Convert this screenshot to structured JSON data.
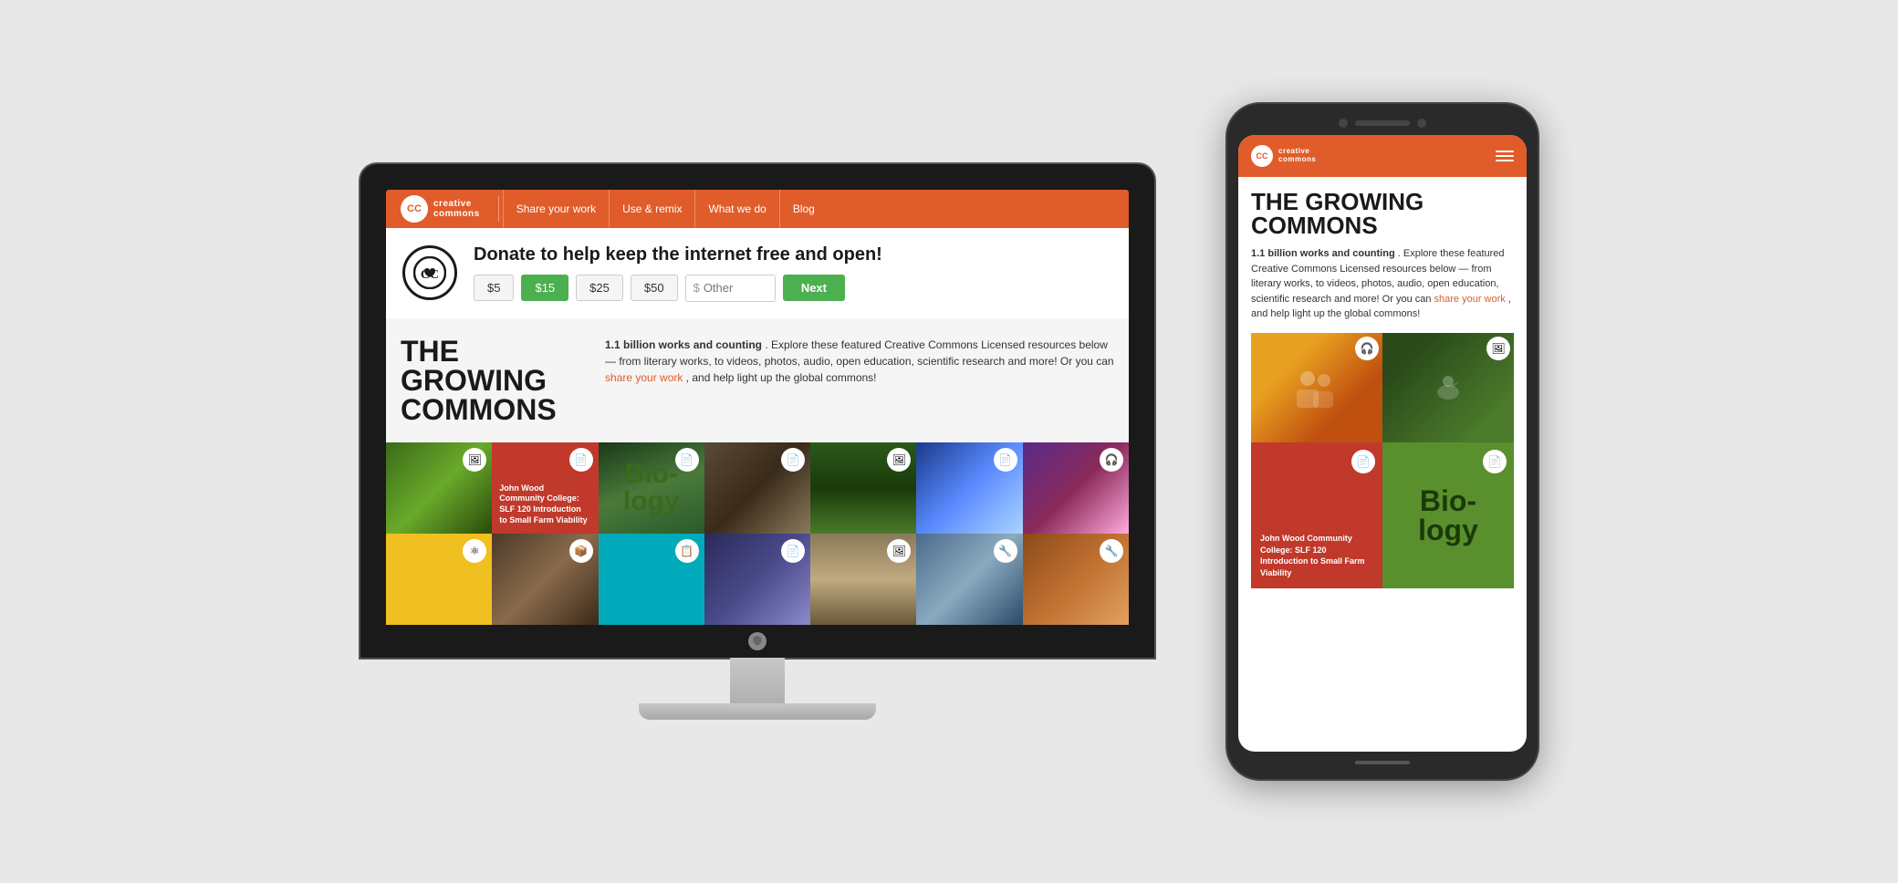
{
  "scene": {
    "bg_color": "#e8e8e8"
  },
  "imac": {
    "nav": {
      "logo_text_line1": "creative",
      "logo_text_line2": "commons",
      "logo_icon": "CC",
      "links": [
        {
          "label": "Share your work"
        },
        {
          "label": "Use & remix"
        },
        {
          "label": "What we do"
        },
        {
          "label": "Blog"
        }
      ]
    },
    "donate": {
      "heading": "Donate to help keep the internet free and open!",
      "amounts": [
        "$5",
        "$15",
        "$25",
        "$50"
      ],
      "active_amount": "$15",
      "other_placeholder": "Other",
      "currency_symbol": "$",
      "next_label": "Next"
    },
    "growing": {
      "title": "THE GROWING COMMONS",
      "desc_strong": "1.1 billion works and counting",
      "desc_rest": ". Explore these featured Creative Commons Licensed resources below — from literary works, to videos, photos, audio, open education, scientific research and more! Or you can ",
      "desc_link": "share your work",
      "desc_end": ", and help light up the global commons!"
    },
    "grid": {
      "row1": [
        {
          "type": "image",
          "img_class": "img-hbird",
          "icon": "🖼",
          "label": ""
        },
        {
          "type": "text_over_red",
          "text": "John Wood Community College: SLF 120 Introduction to Small Farm Viability",
          "icon": "📄"
        },
        {
          "type": "bio_text",
          "text": "Bio-logy",
          "img_class": "img-forest"
        },
        {
          "type": "image",
          "img_class": "img-fist",
          "icon": "📄"
        },
        {
          "type": "image",
          "img_class": "img-trees",
          "icon": "🖼"
        },
        {
          "type": "image",
          "img_class": "img-blue",
          "icon": "📄"
        },
        {
          "type": "image",
          "img_class": "img-purple",
          "icon": "🎧"
        }
      ],
      "row2": [
        {
          "type": "color",
          "color": "cell-yellow",
          "icon": "⚛"
        },
        {
          "type": "image",
          "img_class": "img-face",
          "icon": "📦"
        },
        {
          "type": "color",
          "color": "cell-teal",
          "icon": "📋"
        },
        {
          "type": "image",
          "img_class": "img-triangles",
          "icon": "📄"
        },
        {
          "type": "image",
          "img_class": "img-mushroom",
          "icon": "🖼"
        },
        {
          "type": "image",
          "img_class": "img-circles",
          "icon": "🔧"
        },
        {
          "type": "image",
          "img_class": "img-abstract",
          "icon": "🔧"
        }
      ]
    }
  },
  "phone": {
    "nav": {
      "logo_text_line1": "creative",
      "logo_text_line2": "commons",
      "logo_icon": "CC",
      "menu_icon": "hamburger"
    },
    "content": {
      "title": "THE GROWING COMMONS",
      "desc_strong": "1.1 billion works and counting",
      "desc_rest": ". Explore these featured Creative Commons Licensed resources below — from literary works, to videos, photos, audio, open education, scientific research and more! Or you can ",
      "desc_link": "share your work",
      "desc_end": ", and help light up the global commons!"
    },
    "grid": {
      "cells": [
        {
          "type": "image_people",
          "icon": "🎧"
        },
        {
          "type": "image_hbird",
          "icon": "🖼"
        },
        {
          "type": "red_text",
          "label": "John Wood Community College: SLF 120 Introduction to Small Farm Viability",
          "icon": "📄"
        },
        {
          "type": "green_bio",
          "text": "Bio-logy",
          "icon": "📄"
        }
      ]
    }
  }
}
